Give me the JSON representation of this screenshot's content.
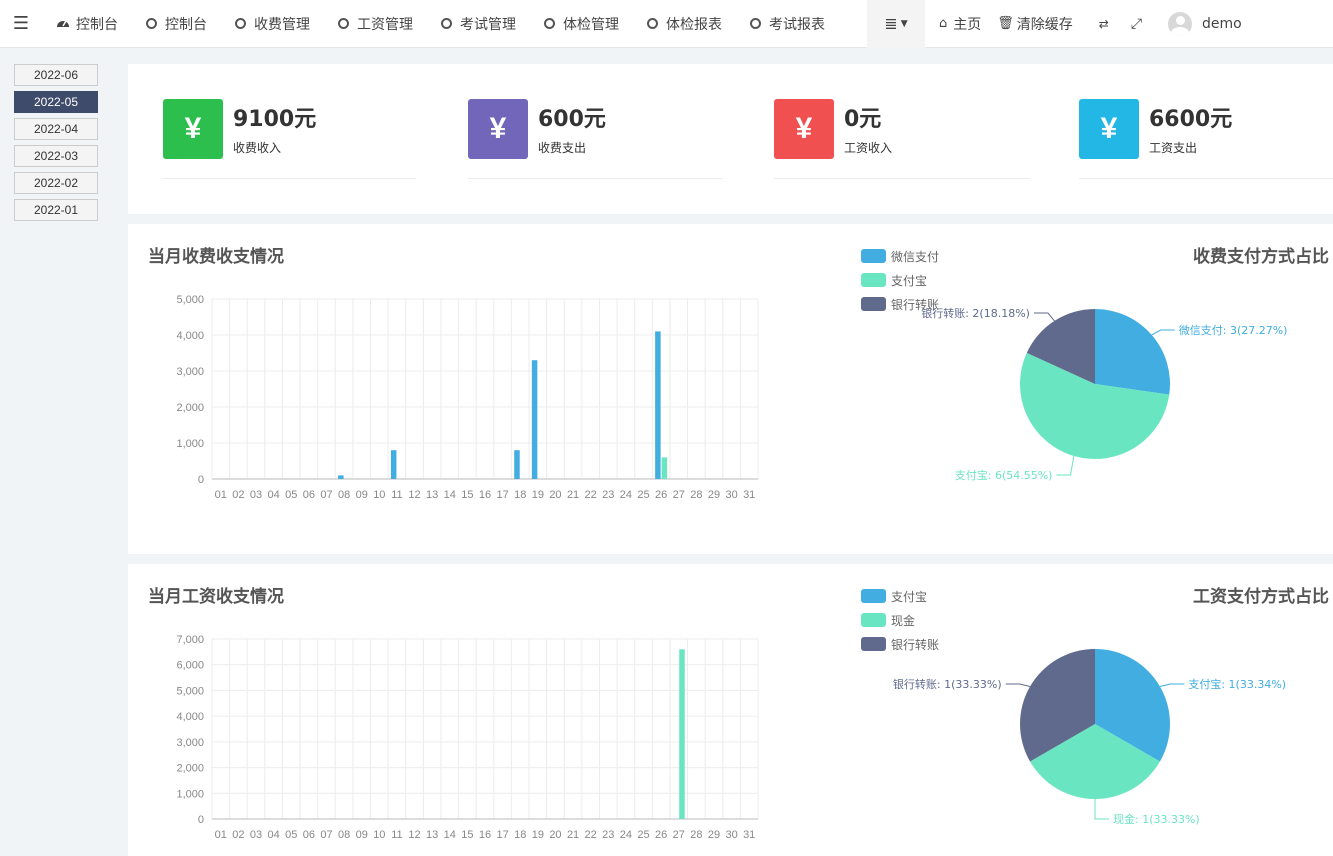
{
  "navbar": {
    "tabs": [
      {
        "label": "控制台",
        "icon": "dashboard-icon"
      },
      {
        "label": "控制台",
        "icon": "circle-icon"
      },
      {
        "label": "收费管理",
        "icon": "circle-icon"
      },
      {
        "label": "工资管理",
        "icon": "circle-icon"
      },
      {
        "label": "考试管理",
        "icon": "circle-icon"
      },
      {
        "label": "体检管理",
        "icon": "circle-icon"
      },
      {
        "label": "体检报表",
        "icon": "circle-icon"
      },
      {
        "label": "考试报表",
        "icon": "circle-icon"
      }
    ],
    "home_label": "主页",
    "clear_cache_label": "清除缓存",
    "username": "demo"
  },
  "months": [
    "2022-06",
    "2022-05",
    "2022-04",
    "2022-03",
    "2022-02",
    "2022-01"
  ],
  "active_month": "2022-05",
  "stats": [
    {
      "value": "9100元",
      "label": "收费收入",
      "color": "#2cbf4d",
      "symbol": "¥"
    },
    {
      "value": "600元",
      "label": "收费支出",
      "color": "#7266ba",
      "symbol": "¥"
    },
    {
      "value": "0元",
      "label": "工资收入",
      "color": "#f05050",
      "symbol": "¥"
    },
    {
      "value": "6600元",
      "label": "工资支出",
      "color": "#23b7e5",
      "symbol": "¥"
    }
  ],
  "fee_section": {
    "title": "当月收费收支情况",
    "pie_title": "收费支付方式占比"
  },
  "salary_section": {
    "title": "当月工资收支情况",
    "pie_title": "工资支付方式占比"
  },
  "chart_data": [
    {
      "type": "bar",
      "categories": [
        "01",
        "02",
        "03",
        "04",
        "05",
        "06",
        "07",
        "08",
        "09",
        "10",
        "11",
        "12",
        "13",
        "14",
        "15",
        "16",
        "17",
        "18",
        "19",
        "20",
        "21",
        "22",
        "23",
        "24",
        "25",
        "26",
        "27",
        "28",
        "29",
        "30",
        "31"
      ],
      "series": [
        {
          "color": "#41ade0",
          "values": [
            0,
            0,
            0,
            0,
            0,
            0,
            0,
            100,
            0,
            0,
            800,
            0,
            0,
            0,
            0,
            0,
            0,
            800,
            3300,
            0,
            0,
            0,
            0,
            0,
            0,
            4100,
            0,
            0,
            0,
            0,
            0
          ]
        },
        {
          "color": "#6ae5c2",
          "values": [
            0,
            0,
            0,
            0,
            0,
            0,
            0,
            0,
            0,
            0,
            0,
            0,
            0,
            0,
            0,
            0,
            0,
            0,
            0,
            0,
            0,
            0,
            0,
            0,
            0,
            600,
            0,
            0,
            0,
            0,
            0
          ]
        }
      ],
      "ylim": [
        0,
        5000
      ],
      "yticks": [
        "0",
        "1,000",
        "2,000",
        "3,000",
        "4,000",
        "5,000"
      ],
      "grid": true
    },
    {
      "type": "pie",
      "legend": [
        "微信支付",
        "支付宝",
        "银行转账"
      ],
      "slices": [
        {
          "name": "微信支付",
          "value": 3,
          "label": "微信支付: 3(27.27%)",
          "color": "#41ade0"
        },
        {
          "name": "支付宝",
          "value": 6,
          "label": "支付宝: 6(54.55%)",
          "color": "#6ae5c2"
        },
        {
          "name": "银行转账",
          "value": 2,
          "label": "银行转账: 2(18.18%)",
          "color": "#5f6a8c"
        }
      ],
      "legend_position": "top-left"
    },
    {
      "type": "bar",
      "categories": [
        "01",
        "02",
        "03",
        "04",
        "05",
        "06",
        "07",
        "08",
        "09",
        "10",
        "11",
        "12",
        "13",
        "14",
        "15",
        "16",
        "17",
        "18",
        "19",
        "20",
        "21",
        "22",
        "23",
        "24",
        "25",
        "26",
        "27",
        "28",
        "29",
        "30",
        "31"
      ],
      "series": [
        {
          "color": "#41ade0",
          "values": [
            0,
            0,
            0,
            0,
            0,
            0,
            0,
            0,
            0,
            0,
            0,
            0,
            0,
            0,
            0,
            0,
            0,
            0,
            0,
            0,
            0,
            0,
            0,
            0,
            0,
            0,
            0,
            0,
            0,
            0,
            0
          ]
        },
        {
          "color": "#6ae5c2",
          "values": [
            0,
            0,
            0,
            0,
            0,
            0,
            0,
            0,
            0,
            0,
            0,
            0,
            0,
            0,
            0,
            0,
            0,
            0,
            0,
            0,
            0,
            0,
            0,
            0,
            0,
            0,
            6600,
            0,
            0,
            0,
            0
          ]
        }
      ],
      "ylim": [
        0,
        7000
      ],
      "yticks": [
        "0",
        "1,000",
        "2,000",
        "3,000",
        "4,000",
        "5,000",
        "6,000",
        "7,000"
      ],
      "grid": true
    },
    {
      "type": "pie",
      "legend": [
        "支付宝",
        "现金",
        "银行转账"
      ],
      "slices": [
        {
          "name": "支付宝",
          "value": 1,
          "label": "支付宝: 1(33.34%)",
          "color": "#41ade0"
        },
        {
          "name": "现金",
          "value": 1,
          "label": "现金: 1(33.33%)",
          "color": "#6ae5c2"
        },
        {
          "name": "银行转账",
          "value": 1,
          "label": "银行转账: 1(33.33%)",
          "color": "#5f6a8c"
        }
      ],
      "legend_position": "top-left"
    }
  ]
}
